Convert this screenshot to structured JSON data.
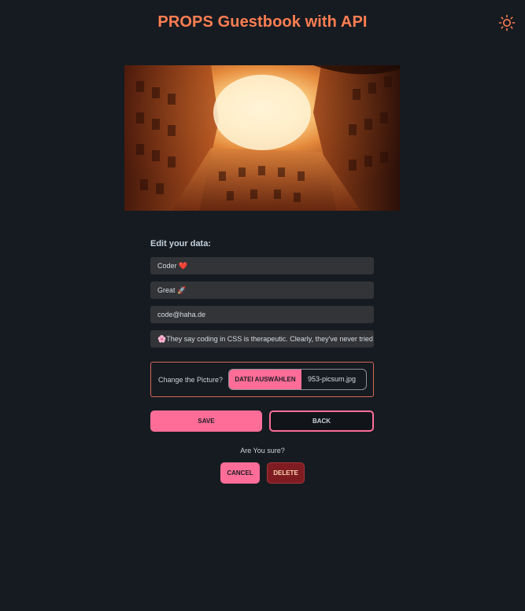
{
  "header": {
    "title": "PROPS Guestbook with API",
    "theme_icon": "sun-icon",
    "title_color": "#ff7e52"
  },
  "hero_image": {
    "alt": "building courtyard photo"
  },
  "form": {
    "heading": "Edit your data:",
    "name_value": "Coder ❤️",
    "rating_value": "Great 🚀",
    "email_value": "code@haha.de",
    "message_value": "🌸They say coding in CSS is therapeutic. Clearly, they've never tried it."
  },
  "file": {
    "label": "Change the Picture?",
    "button_label": "DATEI AUSWÄHLEN",
    "file_name": "953-picsum.jpg"
  },
  "actions": {
    "save_label": "SAVE",
    "back_label": "BACK",
    "confirm_text": "Are You sure?",
    "cancel_label": "CANCEL",
    "delete_label": "DELETE"
  },
  "colors": {
    "background": "#161b21",
    "accent_pink": "#fd6d98",
    "delete_red": "#7e1c22",
    "input_bg": "#323437"
  }
}
